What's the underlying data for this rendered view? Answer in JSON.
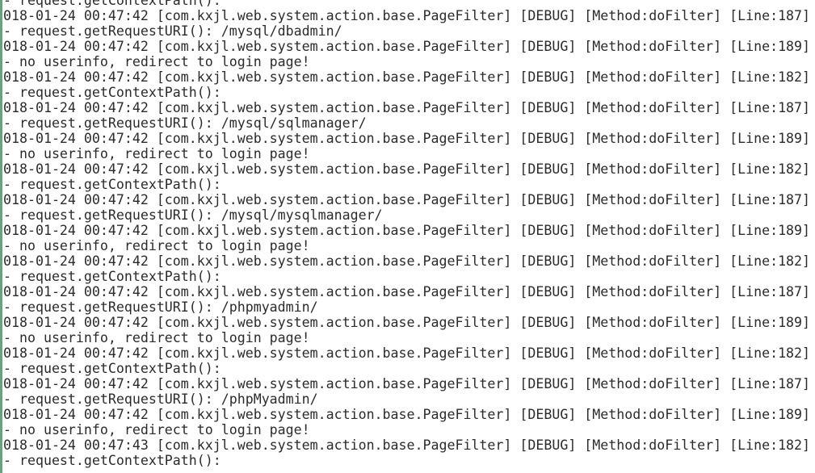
{
  "terminal": {
    "lines": [
      "- request.getContextPath():",
      "018-01-24 00:47:42 [com.kxjl.web.system.action.base.PageFilter] [DEBUG] [Method:doFilter] [Line:187]",
      "- request.getRequestURI(): /mysql/dbadmin/",
      "018-01-24 00:47:42 [com.kxjl.web.system.action.base.PageFilter] [DEBUG] [Method:doFilter] [Line:189]",
      "- no userinfo, redirect to login page!",
      "018-01-24 00:47:42 [com.kxjl.web.system.action.base.PageFilter] [DEBUG] [Method:doFilter] [Line:182]",
      "- request.getContextPath():",
      "018-01-24 00:47:42 [com.kxjl.web.system.action.base.PageFilter] [DEBUG] [Method:doFilter] [Line:187]",
      "- request.getRequestURI(): /mysql/sqlmanager/",
      "018-01-24 00:47:42 [com.kxjl.web.system.action.base.PageFilter] [DEBUG] [Method:doFilter] [Line:189]",
      "- no userinfo, redirect to login page!",
      "018-01-24 00:47:42 [com.kxjl.web.system.action.base.PageFilter] [DEBUG] [Method:doFilter] [Line:182]",
      "- request.getContextPath():",
      "018-01-24 00:47:42 [com.kxjl.web.system.action.base.PageFilter] [DEBUG] [Method:doFilter] [Line:187]",
      "- request.getRequestURI(): /mysql/mysqlmanager/",
      "018-01-24 00:47:42 [com.kxjl.web.system.action.base.PageFilter] [DEBUG] [Method:doFilter] [Line:189]",
      "- no userinfo, redirect to login page!",
      "018-01-24 00:47:42 [com.kxjl.web.system.action.base.PageFilter] [DEBUG] [Method:doFilter] [Line:182]",
      "- request.getContextPath():",
      "018-01-24 00:47:42 [com.kxjl.web.system.action.base.PageFilter] [DEBUG] [Method:doFilter] [Line:187]",
      "- request.getRequestURI(): /phpmyadmin/",
      "018-01-24 00:47:42 [com.kxjl.web.system.action.base.PageFilter] [DEBUG] [Method:doFilter] [Line:189]",
      "- no userinfo, redirect to login page!",
      "018-01-24 00:47:42 [com.kxjl.web.system.action.base.PageFilter] [DEBUG] [Method:doFilter] [Line:182]",
      "- request.getContextPath():",
      "018-01-24 00:47:42 [com.kxjl.web.system.action.base.PageFilter] [DEBUG] [Method:doFilter] [Line:187]",
      "- request.getRequestURI(): /phpMyadmin/",
      "018-01-24 00:47:42 [com.kxjl.web.system.action.base.PageFilter] [DEBUG] [Method:doFilter] [Line:189]",
      "- no userinfo, redirect to login page!",
      "018-01-24 00:47:43 [com.kxjl.web.system.action.base.PageFilter] [DEBUG] [Method:doFilter] [Line:182]",
      "- request.getContextPath():"
    ]
  },
  "colors": {
    "text": "#2b2b2b",
    "background": "#ffffff",
    "left_border": "#6aa37a"
  }
}
